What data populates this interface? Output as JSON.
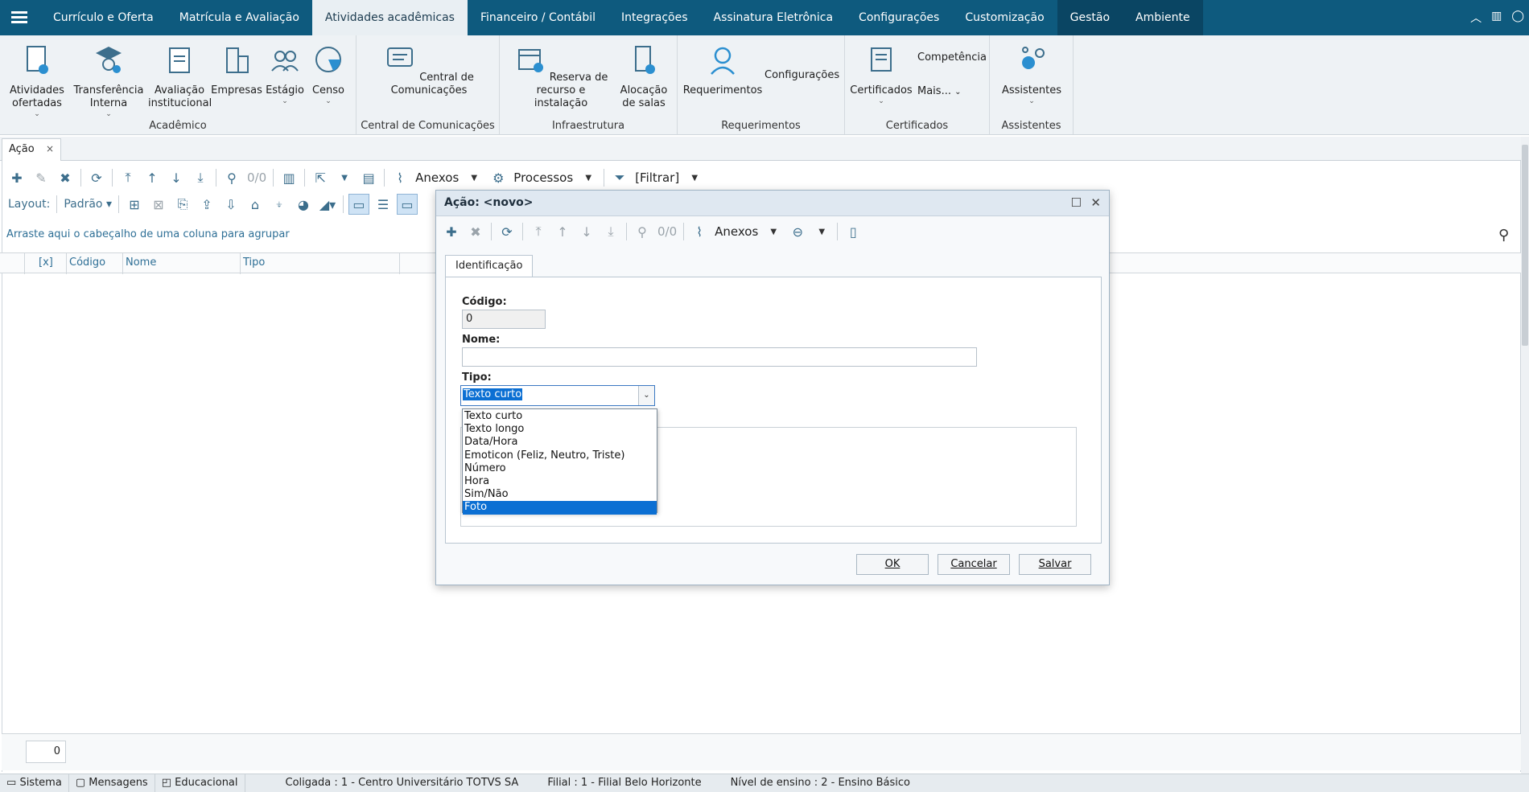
{
  "menu": {
    "tabs": [
      "Currículo e Oferta",
      "Matrícula e Avaliação",
      "Atividades acadêmicas",
      "Financeiro / Contábil",
      "Integrações",
      "Assinatura Eletrônica",
      "Configurações",
      "Customização",
      "Gestão",
      "Ambiente"
    ],
    "active_tab": "Atividades acadêmicas"
  },
  "ribbon": {
    "groups": {
      "academico": "Acadêmico",
      "central": "Central de Comunicações",
      "infra": "Infraestrutura",
      "requerimentos": "Requerimentos",
      "certificados": "Certificados",
      "assistentes": "Assistentes"
    },
    "buttons": {
      "atividades": "Atividades ofertadas",
      "transferencia": "Transferência Interna",
      "avaliacao": "Avaliação institucional",
      "empresas": "Empresas",
      "estagio": "Estágio",
      "censo": "Censo",
      "central": "Central de Comunicações",
      "reserva": "Reserva de recurso e instalação",
      "alocacao": "Alocação de salas",
      "requerimentos": "Requerimentos",
      "configuracoes": "Configurações",
      "certificados": "Certificados",
      "competencia": "Competência",
      "mais": "Mais...",
      "assistentes": "Assistentes"
    }
  },
  "doc_tab": {
    "label": "Ação",
    "close": "×"
  },
  "toolbar": {
    "counter": "0/0",
    "anexos": "Anexos",
    "processos": "Processos",
    "filtrar": "[Filtrar]",
    "layout_label": "Layout:",
    "layout_value": "Padrão"
  },
  "grid": {
    "group_hint": "Arraste aqui o cabeçalho de uma coluna para agrupar",
    "columns": [
      "[x]",
      "Código",
      "Nome",
      "Tipo"
    ],
    "record_count": "0"
  },
  "dialog": {
    "title": "Ação: <novo>",
    "counter": "0/0",
    "anexos": "Anexos",
    "tab": "Identificação",
    "fields": {
      "codigo_label": "Código:",
      "codigo_value": "0",
      "nome_label": "Nome:",
      "nome_value": "",
      "tipo_label": "Tipo:",
      "tipo_value": "Texto curto"
    },
    "tipo_options": [
      "Texto curto",
      "Texto longo",
      "Data/Hora",
      "Emoticon (Feliz, Neutro, Triste)",
      "Número",
      "Hora",
      "Sim/Não",
      "Foto"
    ],
    "tipo_highlighted": "Foto",
    "buttons": {
      "ok": "OK",
      "cancel": "Cancelar",
      "save": "Salvar"
    }
  },
  "statusbar": {
    "sistema": "Sistema",
    "mensagens": "Mensagens",
    "educacional": "Educacional",
    "coligada": "Coligada : 1 - Centro Universitário TOTVS SA",
    "filial": "Filial : 1 - Filial Belo Horizonte",
    "nivel": "Nível de ensino : 2 - Ensino Básico"
  },
  "colors": {
    "menu_bg": "#0e5a7e",
    "accent": "#0b6fd3",
    "icon": "#3c6e8c"
  }
}
